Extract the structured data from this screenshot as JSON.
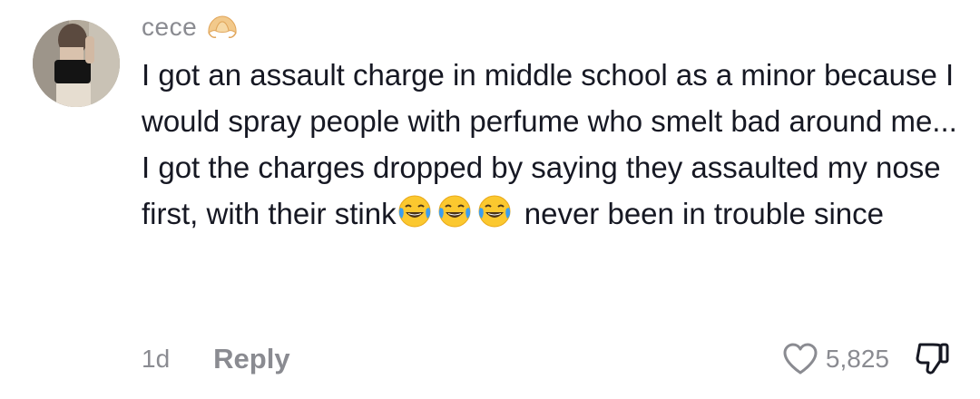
{
  "comment": {
    "username": "cece",
    "username_emoji": "croissant-icon",
    "text_lines_before_emoji": "I got an assault charge in middle school as a minor because I would spray people with perfume who smelt bad around me... I got the charges dropped by saying they assaulted my nose first, with their stink",
    "inline_emojis": [
      "face-with-tears-of-joy-icon",
      "face-with-tears-of-joy-icon",
      "face-with-tears-of-joy-icon"
    ],
    "text_after_emoji": " never been in trouble since",
    "timestamp": "1d",
    "reply_label": "Reply",
    "like_count": "5,825",
    "like_icon": "heart-outline-icon",
    "dislike_icon": "thumbs-down-outline-icon"
  },
  "colors": {
    "primary_text": "#161823",
    "secondary_text": "#8a8b91",
    "background": "#ffffff"
  }
}
